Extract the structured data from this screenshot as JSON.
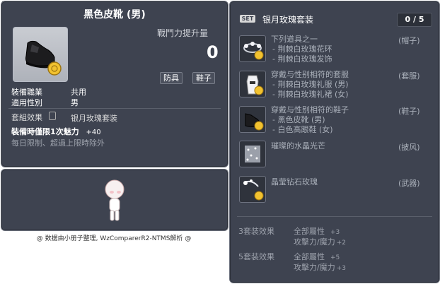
{
  "item_id": "01070149",
  "item": {
    "name": "黑色皮靴 (男)",
    "power_label": "戰鬥力提升量",
    "power_value": "0",
    "tags": [
      "防具",
      "鞋子"
    ],
    "job_key": "裝備職業",
    "job_val": "共用",
    "gender_key": "適用性別",
    "gender_val": "男",
    "set_effect_key": "套組效果",
    "set_effect_val": "银月玫瑰套装",
    "limit_line1": "裝備時僅限1次魅力",
    "limit_bonus": "+40",
    "limit_line2": "每日限制、超過上限時除外"
  },
  "footer": "@ 数据由小册子整理, WzComparerR2-NTMS解析 @",
  "set": {
    "badge": "SET",
    "name": "银月玫瑰套装",
    "count": "0 / 5",
    "slots": [
      {
        "line1": "下列道具之一",
        "sub1": "- 荆棘白玫瑰花环",
        "sub2": "- 荆棘白玫瑰发饰",
        "type": "(帽子)"
      },
      {
        "line1": "穿戴与性别相符的套服",
        "sub1": "- 荆棘白玫瑰礼服 (男)",
        "sub2": "- 荆棘白玫瑰礼裙 (女)",
        "type": "(套服)"
      },
      {
        "line1": "穿戴与性别相符的鞋子",
        "sub1": "- 黑色皮靴 (男)",
        "sub2": "- 白色高跟鞋 (女)",
        "type": "(鞋子)"
      },
      {
        "line1": "璀璨的水晶光芒",
        "type": "(披风)"
      },
      {
        "line1": "晶莹钻石玫瑰",
        "type": "(武器)"
      }
    ],
    "bonuses": [
      {
        "label": "3套装效果",
        "l1": "全部屬性",
        "v1": "+3",
        "l2": "攻擊力/魔力",
        "v2": "+2"
      },
      {
        "label": "5套装效果",
        "l1": "全部屬性",
        "v1": "+5",
        "l2": "攻擊力/魔力",
        "v2": "+3"
      }
    ]
  }
}
